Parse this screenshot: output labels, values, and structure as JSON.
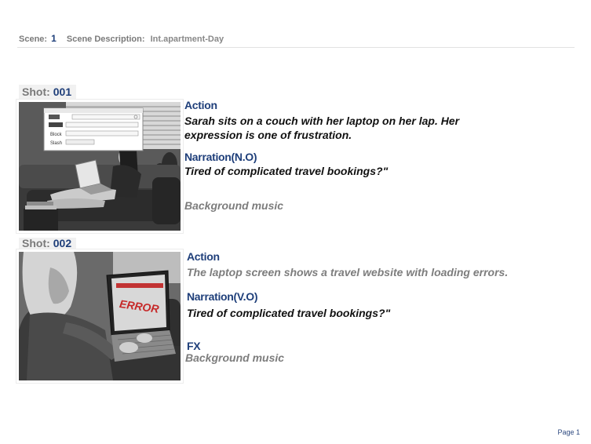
{
  "scene": {
    "label": "Scene:",
    "number": "1",
    "description_label": "Scene Description:",
    "description": "Int.apartment-Day"
  },
  "shots": [
    {
      "label": "Shot:",
      "id": "001",
      "image_icon": "woman-laptop-couch-illustration",
      "screen_lines": [
        "Block",
        "Slash"
      ],
      "action_heading": "Action",
      "action_text": "Sarah sits on a couch with her laptop on her lap. Her expression is one of frustration.",
      "narration_heading": "Narration(N.O)",
      "narration_text": "Tired of complicated travel bookings?\"",
      "sound_text": "Background music"
    },
    {
      "label": "Shot:",
      "id": "002",
      "image_icon": "woman-laptop-error-illustration",
      "screen_error": "ERROR",
      "action_heading": "Action",
      "action_text": "The laptop screen shows a travel website with loading errors.",
      "narration_heading": "Narration(V.O)",
      "narration_text": "Tired of complicated travel bookings?\"",
      "fx_heading": "FX",
      "fx_text": "Background music"
    }
  ],
  "footer": {
    "page": "Page 1"
  },
  "colors": {
    "heading": "#1f3f7a",
    "muted": "#7d7d7d"
  }
}
